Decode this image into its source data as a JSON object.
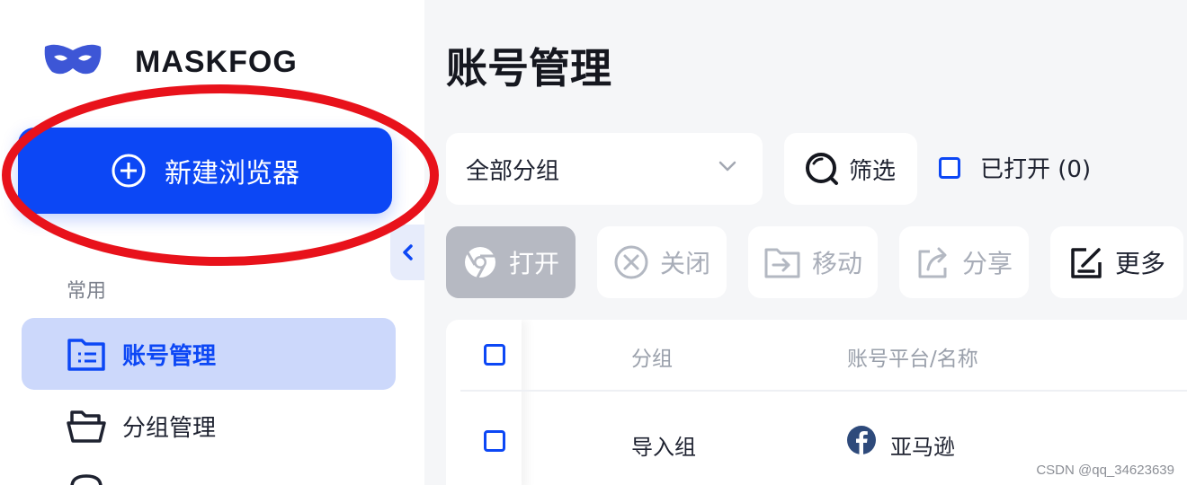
{
  "brand": {
    "name": "MASKFOG"
  },
  "sidebar": {
    "new_browser_label": "新建浏览器",
    "section_label": "常用",
    "items": [
      {
        "label": "账号管理",
        "icon": "account-folder-icon",
        "active": true
      },
      {
        "label": "分组管理",
        "icon": "open-folder-icon",
        "active": false
      }
    ]
  },
  "main": {
    "title": "账号管理",
    "group_select": {
      "value": "全部分组"
    },
    "filter_label": "筛选",
    "opened_checkbox_label": "已打开 (0)",
    "actions": [
      {
        "label": "打开",
        "icon": "chrome-icon"
      },
      {
        "label": "关闭",
        "icon": "close-circle-icon"
      },
      {
        "label": "移动",
        "icon": "move-folder-icon"
      },
      {
        "label": "分享",
        "icon": "share-icon"
      },
      {
        "label": "更多",
        "icon": "edit-icon"
      }
    ],
    "table": {
      "columns": [
        "分组",
        "账号平台/名称"
      ],
      "rows": [
        {
          "group": "导入组",
          "platform_icon": "facebook-icon",
          "platform_name": "亚马逊"
        }
      ]
    }
  },
  "watermark": "CSDN @qq_34623639",
  "colors": {
    "accent": "#0c47f5",
    "annotation": "#e8121b",
    "active_bg": "#ccd8fb"
  }
}
